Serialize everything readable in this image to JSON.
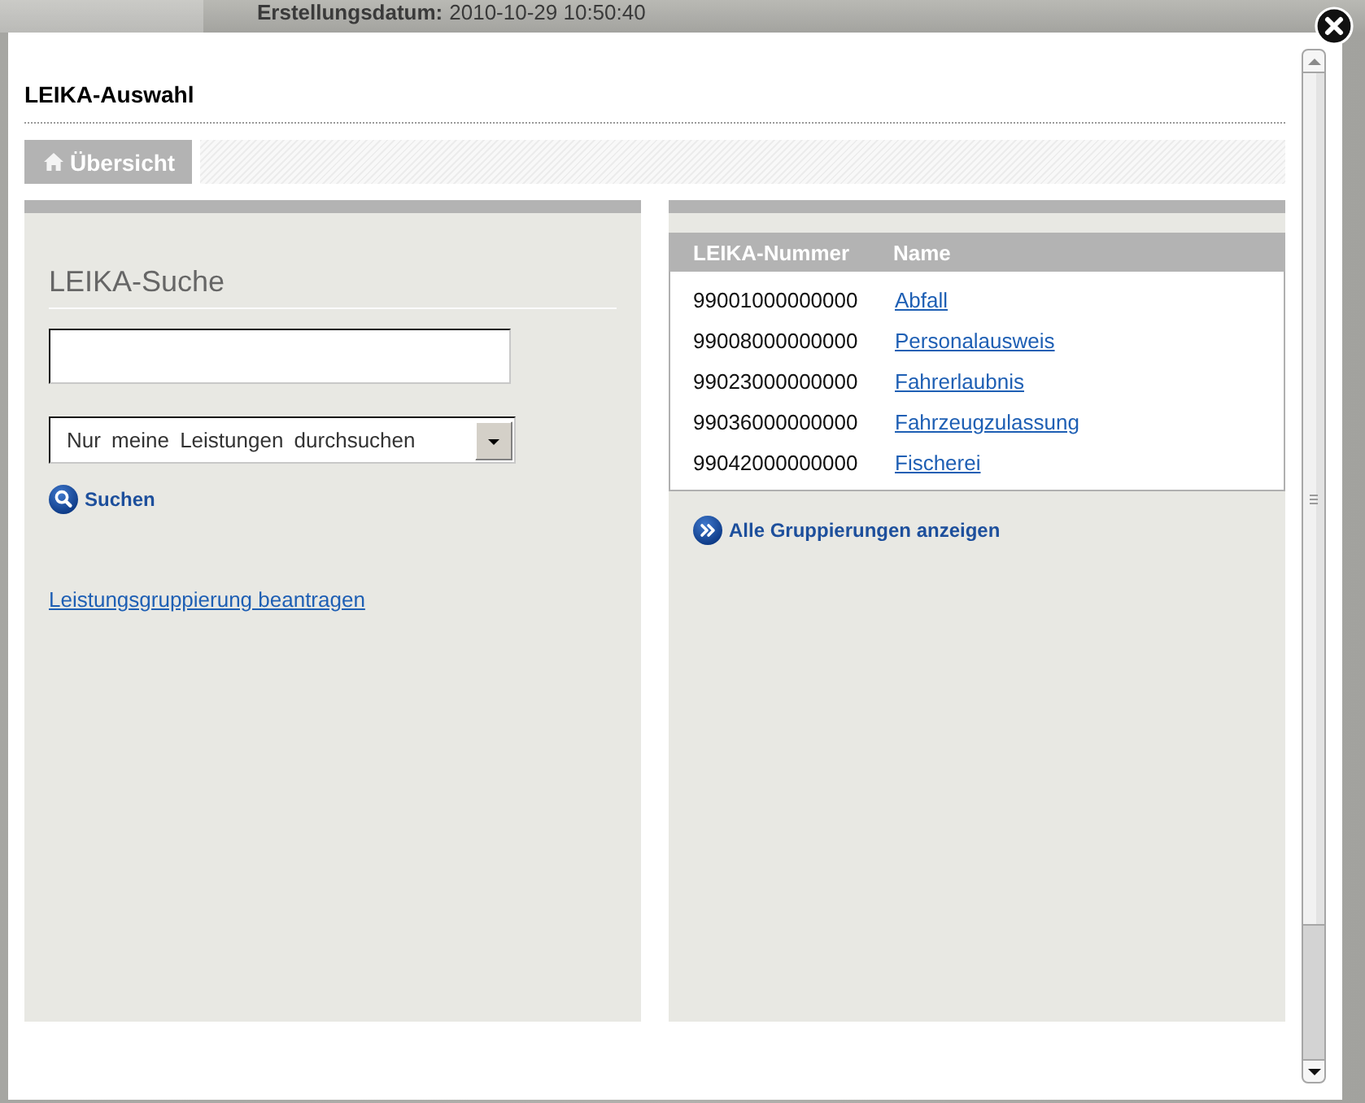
{
  "page": {
    "created_label": "Erstellungsdatum:",
    "created_value": "2010-10-29 10:50:40"
  },
  "dialog": {
    "title": "LEIKA-Auswahl"
  },
  "tabs": [
    {
      "label": "Übersicht",
      "selected": true
    }
  ],
  "search_panel": {
    "heading": "LEIKA-Suche",
    "scope_select": {
      "value": "Nur meine Leistungen durchsuchen"
    },
    "search_link": "Suchen",
    "request_link": "Leistungsgruppierung beantragen"
  },
  "results_panel": {
    "table": {
      "columns": [
        "LEIKA-Nummer",
        "Name"
      ],
      "rows": [
        {
          "number": "99001000000000",
          "name": "Abfall"
        },
        {
          "number": "99008000000000",
          "name": "Personalausweis"
        },
        {
          "number": "99023000000000",
          "name": "Fahrerlaubnis"
        },
        {
          "number": "99036000000000",
          "name": "Fahrzeugzulassung"
        },
        {
          "number": "99042000000000",
          "name": "Fischerei"
        }
      ]
    },
    "show_all_link": "Alle Gruppierungen anzeigen"
  }
}
